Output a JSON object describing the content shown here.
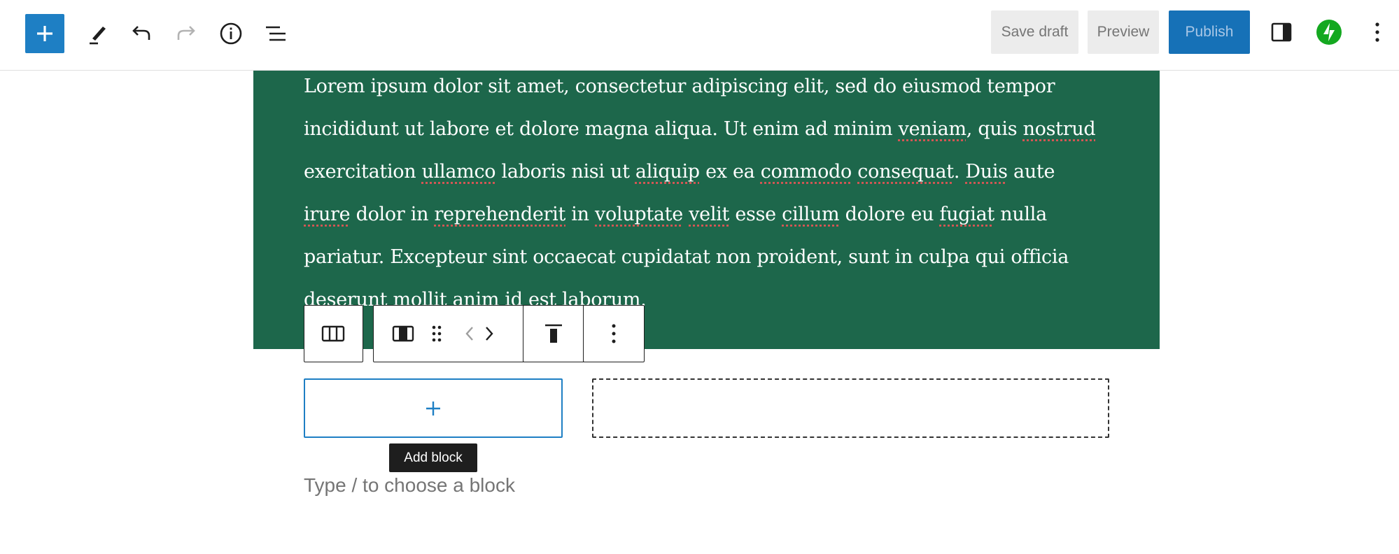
{
  "toolbar": {
    "add_block_icon": "plus-icon",
    "tools_icon": "pencil-icon",
    "undo_icon": "undo-icon",
    "redo_icon": "redo-icon",
    "details_icon": "info-icon",
    "list_view_icon": "list-view-icon",
    "save_draft_label": "Save draft",
    "preview_label": "Preview",
    "publish_label": "Publish",
    "settings_icon": "sidebar-toggle-icon",
    "jetpack_icon": "jetpack-icon",
    "options_icon": "more-vertical-icon",
    "accent_color": "#1e7fc4",
    "jetpack_color": "#14a820"
  },
  "cover": {
    "background_color": "#1d674b",
    "lines": [
      [
        "Lorem ipsum dolor sit amet, consectetur adipiscing elit, sed do eiusmod tempor"
      ],
      [
        "incididunt ut labore et dolore magna aliqua. Ut enim ad minim ",
        "veniam",
        ", quis ",
        "nostrud"
      ],
      [
        "exercitation ",
        "ullamco",
        " laboris nisi ut ",
        "aliquip",
        " ex ea ",
        "commodo",
        " ",
        "consequat",
        ". ",
        "Duis",
        " aute"
      ],
      [
        "irure",
        " dolor in ",
        "reprehenderit",
        " in ",
        "voluptate",
        " ",
        "velit",
        " esse ",
        "cillum",
        " dolore eu ",
        "fugiat",
        " nulla"
      ],
      [
        "pariatur. Excepteur sint occaecat cupidatat non proident, sunt in culpa qui officia"
      ],
      [
        "deserunt mollit anim id est laborum."
      ]
    ]
  },
  "block_toolbar": {
    "parent_icon": "columns-icon",
    "block_type_icon": "column-icon",
    "drag_icon": "drag-handle-icon",
    "move_left_icon": "chevron-left-icon",
    "move_right_icon": "chevron-right-icon",
    "align_icon": "align-top-icon",
    "more_icon": "more-vertical-icon"
  },
  "columns": {
    "add_block_tooltip": "Add block",
    "add_icon": "plus-icon"
  },
  "placeholder": "Type / to choose a block"
}
